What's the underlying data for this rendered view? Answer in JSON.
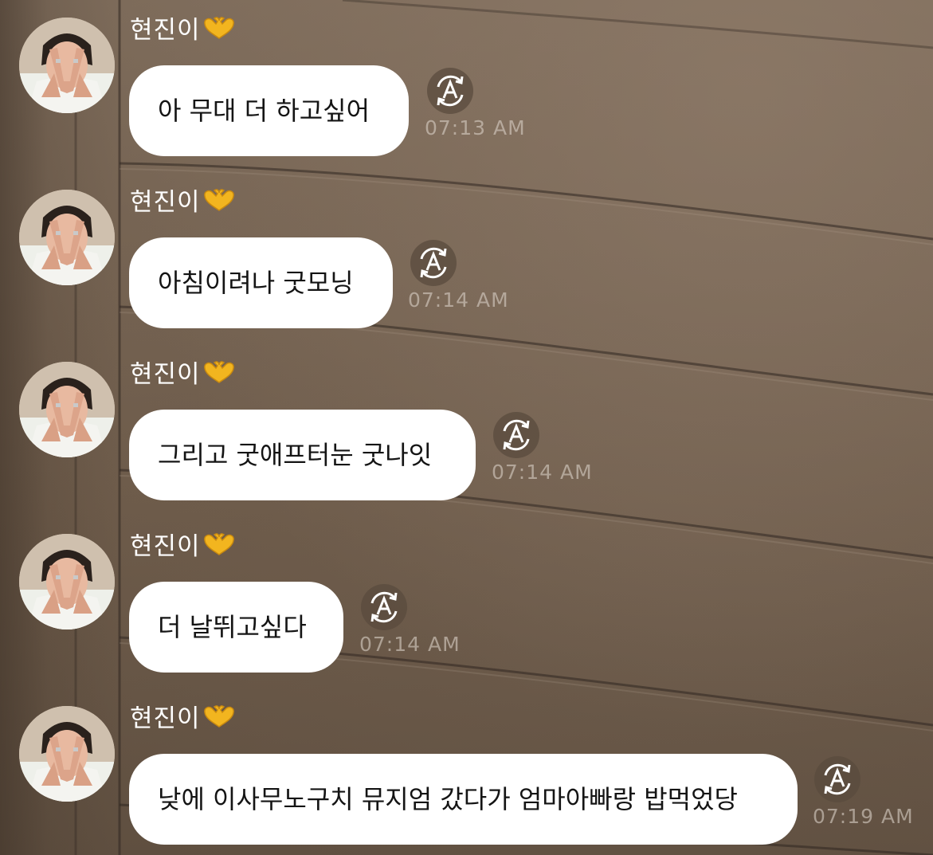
{
  "chat": {
    "sender_name": "현진이",
    "sender_emoji": "heart-hands",
    "messages": [
      {
        "text": "아 무대 더 하고싶어",
        "time": "07:13 AM"
      },
      {
        "text": "아침이려나 굿모닝",
        "time": "07:14 AM"
      },
      {
        "text": "그리고 굿애프터눈 굿나잇",
        "time": "07:14 AM"
      },
      {
        "text": "더 날뛰고싶다",
        "time": "07:14 AM"
      },
      {
        "text": "낮에 이사무노구치 뮤지엄 갔다가 엄마아빠랑 밥먹었당",
        "time": "07:19 AM"
      }
    ]
  },
  "colors": {
    "bubble": "#ffffff",
    "bubble_text": "#141414",
    "name_text": "#ffffff",
    "time_text": "#d7cdc3",
    "emoji": "#f2b51f"
  },
  "icons": {
    "translate": "auto-translate-icon",
    "avatar": "profile-avatar"
  }
}
